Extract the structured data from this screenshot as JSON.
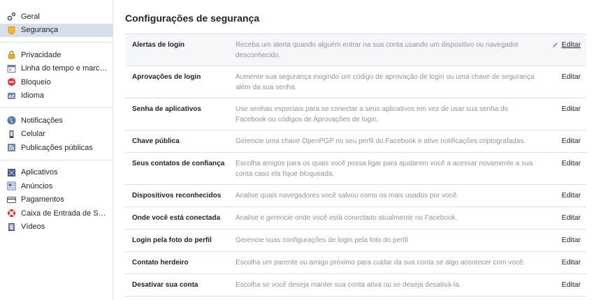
{
  "sidebar": {
    "groups": [
      [
        {
          "label": "Geral",
          "icon": "gear-icon"
        },
        {
          "label": "Segurança",
          "icon": "shield-icon",
          "active": true
        }
      ],
      [
        {
          "label": "Privacidade",
          "icon": "lock-icon"
        },
        {
          "label": "Linha do tempo e marca...",
          "icon": "timeline-icon"
        },
        {
          "label": "Bloqueio",
          "icon": "block-icon"
        },
        {
          "label": "Idioma",
          "icon": "language-icon"
        }
      ],
      [
        {
          "label": "Notificações",
          "icon": "globe-icon"
        },
        {
          "label": "Celular",
          "icon": "mobile-icon"
        },
        {
          "label": "Publicações públicas",
          "icon": "rss-icon"
        }
      ],
      [
        {
          "label": "Aplicativos",
          "icon": "apps-icon"
        },
        {
          "label": "Anúncios",
          "icon": "ads-icon"
        },
        {
          "label": "Pagamentos",
          "icon": "card-icon"
        },
        {
          "label": "Caixa de Entrada de Su...",
          "icon": "lifebuoy-icon"
        },
        {
          "label": "Vídeos",
          "icon": "film-icon"
        }
      ]
    ]
  },
  "main": {
    "title": "Configurações de segurança",
    "rows": [
      {
        "name": "Alertas de login",
        "desc": "Receba um alerta quando alguém entrar na sua conta usando um dispositivo ou navegador desconhecido.",
        "edit": "Editar"
      },
      {
        "name": "Aprovações de login",
        "desc": "Aumente sua segurança exigindo um código de aprovação de login ou uma chave de segurança além da sua senha.",
        "edit": "Editar"
      },
      {
        "name": "Senha de aplicativos",
        "desc": "Use senhas especiais para se conectar a seus aplicativos em vez de usar sua senha do Facebook ou códigos de Aprovações de login.",
        "edit": "Editar"
      },
      {
        "name": "Chave pública",
        "desc": "Gerencie uma chave OpenPGP no seu perfil do Facebook e ative notificações criptografadas.",
        "edit": "Editar"
      },
      {
        "name": "Seus contatos de confiança",
        "desc": "Escolha amigos para os quais você possa ligar para ajudarem você a acessar novamente a sua conta caso ela fique bloqueada.",
        "edit": "Editar"
      },
      {
        "name": "Dispositivos reconhecidos",
        "desc": "Analise quais navegadores você salvou como os mais usados por você.",
        "edit": "Editar"
      },
      {
        "name": "Onde você está conectada",
        "desc": "Analise e gerencie onde você está conectado atualmente no Facebook.",
        "edit": "Editar"
      },
      {
        "name": "Login pela foto do perfil",
        "desc": "Gerencie suas configurações de login pela foto do perfil",
        "edit": "Editar"
      },
      {
        "name": "Contato herdeiro",
        "desc": "Escolha um parente ou amigo próximo para cuidar da sua conta se algo acontecer com você.",
        "edit": "Editar"
      },
      {
        "name": "Desativar sua conta",
        "desc": "Escolha se você deseja manter sua conta ativa ou se deseja desativá-la.",
        "edit": "Editar"
      }
    ]
  }
}
